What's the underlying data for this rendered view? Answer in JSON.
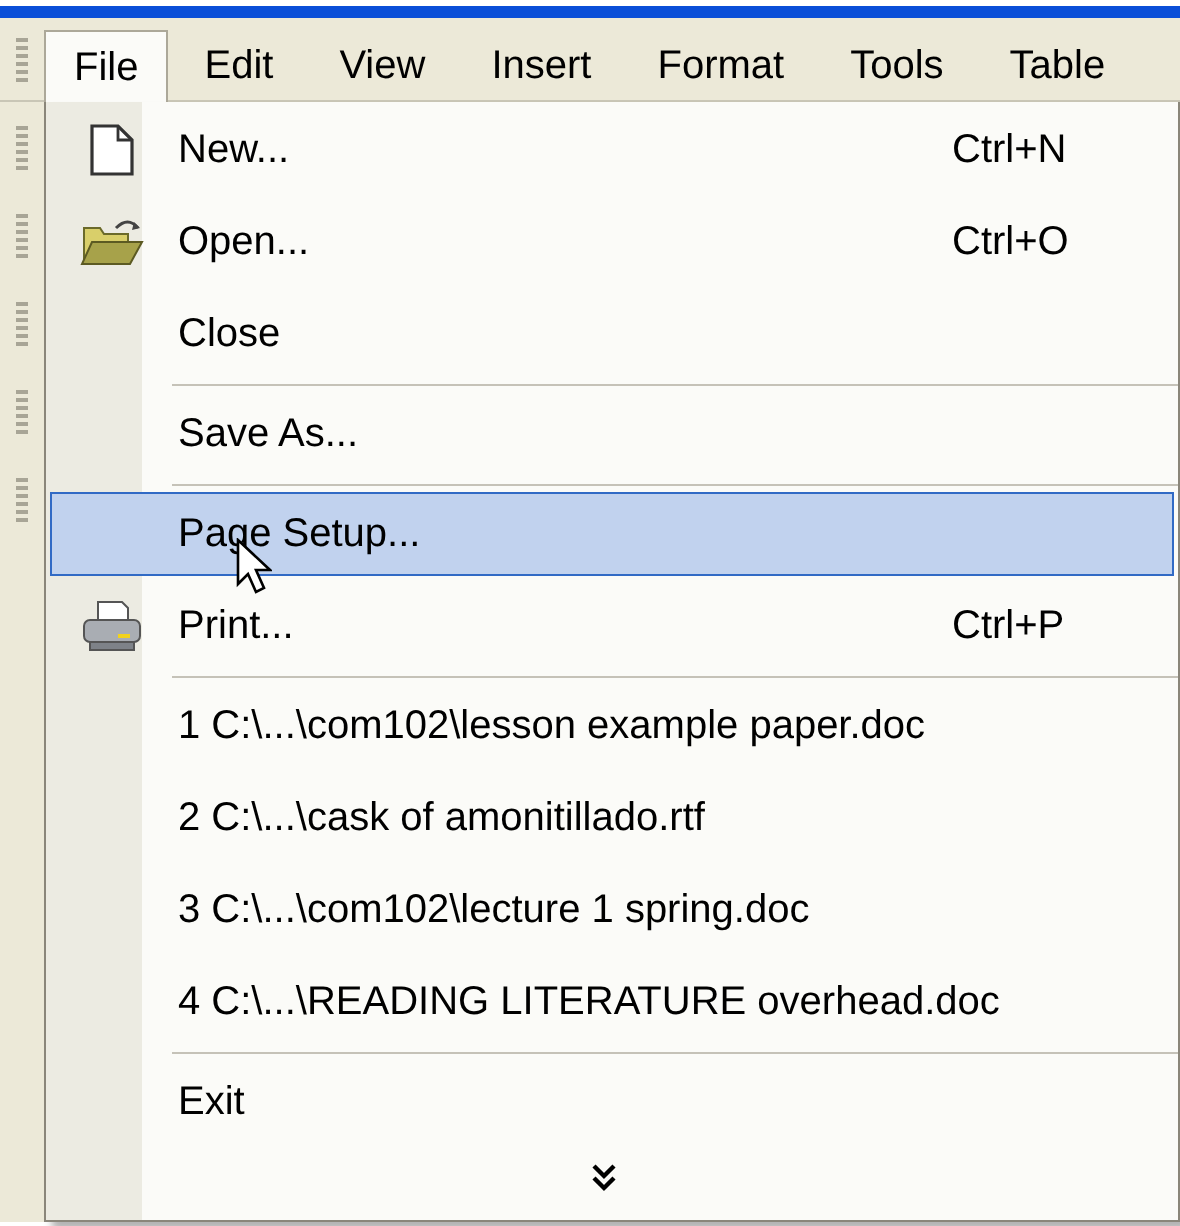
{
  "menu_bar": [
    {
      "label": "File",
      "selected": true
    },
    {
      "label": "Edit",
      "selected": false
    },
    {
      "label": "View",
      "selected": false
    },
    {
      "label": "Insert",
      "selected": false
    },
    {
      "label": "Format",
      "selected": false
    },
    {
      "label": "Tools",
      "selected": false
    },
    {
      "label": "Table",
      "selected": false
    }
  ],
  "file_menu": {
    "items": [
      {
        "kind": "item",
        "label": "New...",
        "shortcut": "Ctrl+N",
        "selected": false
      },
      {
        "kind": "item",
        "label": "Open...",
        "shortcut": "Ctrl+O",
        "selected": false
      },
      {
        "kind": "item",
        "label": "Close",
        "selected": false
      },
      {
        "kind": "separator"
      },
      {
        "kind": "item",
        "label": "Save As...",
        "selected": false
      },
      {
        "kind": "separator"
      },
      {
        "kind": "item",
        "label": "Page Setup...",
        "selected": true
      },
      {
        "kind": "item",
        "label": "Print...",
        "shortcut": "Ctrl+P",
        "selected": false
      },
      {
        "kind": "separator"
      },
      {
        "kind": "item",
        "label": "1 C:\\...\\com102\\lesson example paper.doc",
        "selected": false
      },
      {
        "kind": "item",
        "label": "2 C:\\...\\cask of amonitillado.rtf",
        "selected": false
      },
      {
        "kind": "item",
        "label": "3 C:\\...\\com102\\lecture 1 spring.doc",
        "selected": false
      },
      {
        "kind": "item",
        "label": "4 C:\\...\\READING LITERATURE overhead.doc",
        "selected": false
      },
      {
        "kind": "separator"
      },
      {
        "kind": "item",
        "label": "Exit",
        "selected": false
      },
      {
        "kind": "more"
      }
    ]
  }
}
